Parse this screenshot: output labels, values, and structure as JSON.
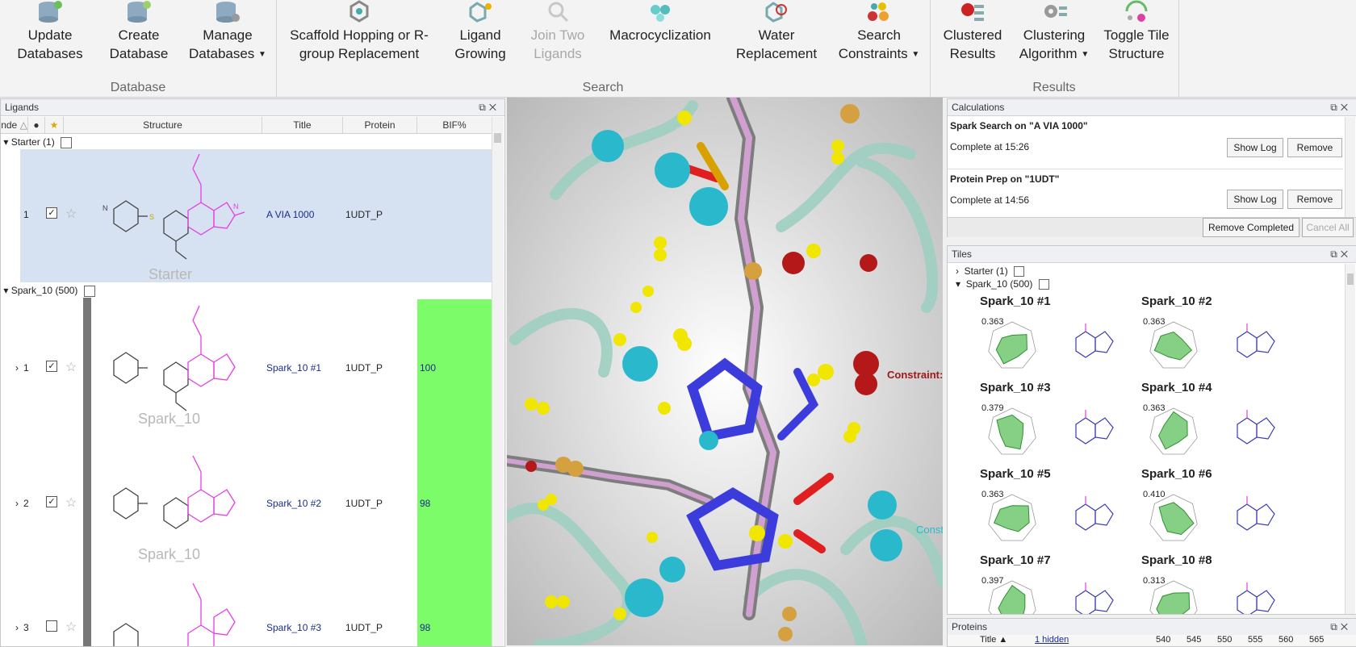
{
  "ribbon": {
    "groups": [
      {
        "label": "Database",
        "buttons": [
          {
            "label1": "Update",
            "label2": "Databases",
            "has_caret": false,
            "disabled": false
          },
          {
            "label1": "Create",
            "label2": "Database",
            "has_caret": false,
            "disabled": false
          },
          {
            "label1": "Manage",
            "label2": "Databases",
            "has_caret": true,
            "disabled": false
          }
        ]
      },
      {
        "label": "Search",
        "buttons": [
          {
            "label1": "Scaffold Hopping or R-",
            "label2": "group Replacement",
            "has_caret": false,
            "disabled": false
          },
          {
            "label1": "Ligand",
            "label2": "Growing",
            "has_caret": false,
            "disabled": false
          },
          {
            "label1": "Join Two",
            "label2": "Ligands",
            "has_caret": false,
            "disabled": true
          },
          {
            "label1": "Macrocyclization",
            "label2": "",
            "has_caret": false,
            "disabled": false
          },
          {
            "label1": "Water",
            "label2": "Replacement",
            "has_caret": false,
            "disabled": false
          },
          {
            "label1": "Search",
            "label2": "Constraints",
            "has_caret": true,
            "disabled": false
          }
        ]
      },
      {
        "label": "Results",
        "buttons": [
          {
            "label1": "Clustered",
            "label2": "Results",
            "has_caret": false,
            "disabled": false
          },
          {
            "label1": "Clustering",
            "label2": "Algorithm",
            "has_caret": true,
            "disabled": false
          },
          {
            "label1": "Toggle Tile",
            "label2": "Structure",
            "has_caret": false,
            "disabled": false
          }
        ]
      }
    ]
  },
  "ligands": {
    "title": "Ligands",
    "columns": {
      "index": "nde",
      "structure": "Structure",
      "title": "Title",
      "protein": "Protein",
      "bif": "BIF%"
    },
    "groups": [
      {
        "name": "Starter (1)",
        "rows": [
          {
            "index": "1",
            "checked": true,
            "title": "A VIA 1000",
            "protein": "1UDT_P",
            "bif": "",
            "watermark": "Starter"
          }
        ]
      },
      {
        "name": "Spark_10 (500)",
        "rows": [
          {
            "index": "1",
            "checked": true,
            "title": "Spark_10 #1",
            "protein": "1UDT_P",
            "bif": "100",
            "watermark": "Spark_10"
          },
          {
            "index": "2",
            "checked": true,
            "title": "Spark_10 #2",
            "protein": "1UDT_P",
            "bif": "98",
            "watermark": "Spark_10"
          },
          {
            "index": "3",
            "checked": false,
            "title": "Spark_10 #3",
            "protein": "1UDT_P",
            "bif": "98",
            "watermark": ""
          }
        ]
      }
    ]
  },
  "viewer": {
    "label_constraint": "Constraint:",
    "label_const": "Const"
  },
  "calculations": {
    "title": "Calculations",
    "items": [
      {
        "name": "Spark Search on \"A VIA 1000\"",
        "status": "Complete at 15:26",
        "show_log": "Show Log",
        "remove": "Remove"
      },
      {
        "name": "Protein Prep on \"1UDT\"",
        "status": "Complete at 14:56",
        "show_log": "Show Log",
        "remove": "Remove"
      }
    ],
    "remove_completed": "Remove Completed",
    "cancel_all": "Cancel All"
  },
  "tiles": {
    "title": "Tiles",
    "groups": [
      "Starter (1)",
      "Spark_10 (500)"
    ],
    "items": [
      {
        "name": "Spark_10 #1",
        "score": "0.363"
      },
      {
        "name": "Spark_10 #2",
        "score": "0.363"
      },
      {
        "name": "Spark_10 #3",
        "score": "0.379"
      },
      {
        "name": "Spark_10 #4",
        "score": "0.363"
      },
      {
        "name": "Spark_10 #5",
        "score": "0.363"
      },
      {
        "name": "Spark_10 #6",
        "score": "0.410"
      },
      {
        "name": "Spark_10 #7",
        "score": "0.397"
      },
      {
        "name": "Spark_10 #8",
        "score": "0.313"
      }
    ]
  },
  "proteins": {
    "title": "Proteins",
    "col_title": "Title",
    "hidden": "1 hidden",
    "ruler": [
      "540",
      "545",
      "550",
      "555",
      "560",
      "565"
    ]
  },
  "colors": {
    "accent_title": "#1a2d8f",
    "bif_green": "#7cfc68",
    "selected_row": "#d6e2f2"
  }
}
